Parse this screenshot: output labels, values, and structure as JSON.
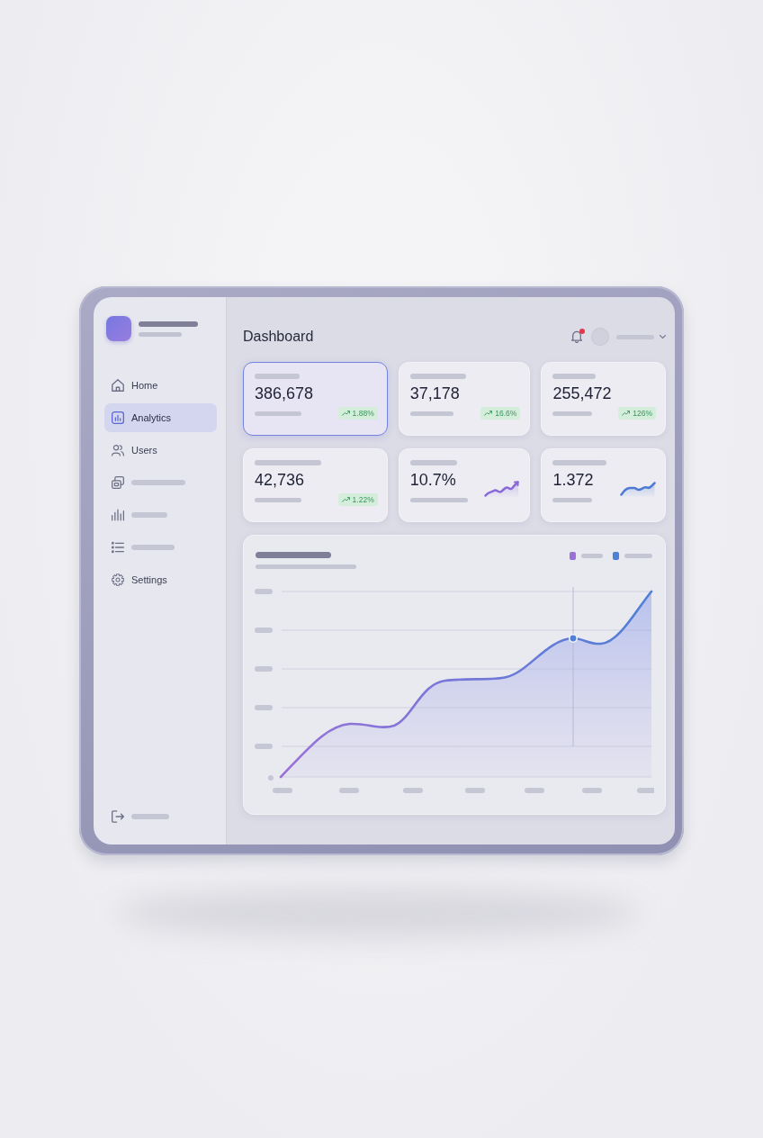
{
  "sidebar": {
    "items": [
      {
        "kind": "label",
        "label": "Home",
        "selected": false
      },
      {
        "kind": "label",
        "label": "Analytics",
        "selected": true
      },
      {
        "kind": "label",
        "label": "Users",
        "selected": false
      },
      {
        "kind": "placeholder",
        "selected": false
      },
      {
        "kind": "placeholder",
        "selected": false
      },
      {
        "kind": "placeholder",
        "selected": false
      },
      {
        "kind": "label",
        "label": "Settings",
        "selected": false
      }
    ]
  },
  "header": {
    "title": "Dashboard",
    "notifications": {
      "unread": true
    }
  },
  "cards": [
    {
      "kind": "badge",
      "value": "386,678",
      "change": "1.88%",
      "selected": true
    },
    {
      "kind": "badge",
      "value": "37,178",
      "change": "16.6%",
      "selected": false
    },
    {
      "kind": "badge",
      "value": "255,472",
      "change": "126%",
      "selected": false
    },
    {
      "kind": "badge",
      "value": "42,736",
      "change": "1.22%",
      "selected": false
    },
    {
      "kind": "sparkline",
      "value": "10.7%",
      "color": "#8a68d8",
      "selected": false
    },
    {
      "kind": "sparkline",
      "value": "1.372",
      "color": "#4f7ad4",
      "selected": false
    }
  ],
  "chart": {
    "legend": [
      {
        "color": "#9a70d8"
      },
      {
        "color": "#4f7fd6"
      }
    ]
  }
}
